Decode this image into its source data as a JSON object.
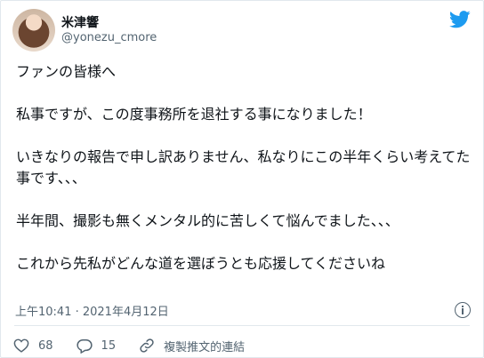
{
  "user": {
    "name": "米津響",
    "handle": "@yonezu_cmore"
  },
  "tweet": {
    "paragraphs": [
      "ファンの皆様へ",
      "私事ですが、この度事務所を退社する事になりました！",
      "いきなりの報告で申し訳ありません、私なりにこの半年くらい考えてた事です、、、",
      "半年間、撮影も無くメンタル的に苦しくて悩んでました、、、",
      "これから先私がどんな道を選ぼうとも応援してくださいね"
    ],
    "timestamp": "上午10:41 · 2021年4月12日"
  },
  "actions": {
    "likes": "68",
    "replies": "15",
    "copy_link": "複製推文的連結"
  },
  "icons": {
    "logo": "twitter-bird-icon",
    "info": "info-icon",
    "like": "heart-icon",
    "reply": "reply-bubble-icon",
    "link": "link-icon"
  },
  "colors": {
    "brand": "#1d9bf0",
    "text": "#0f1419",
    "secondary": "#536471"
  }
}
